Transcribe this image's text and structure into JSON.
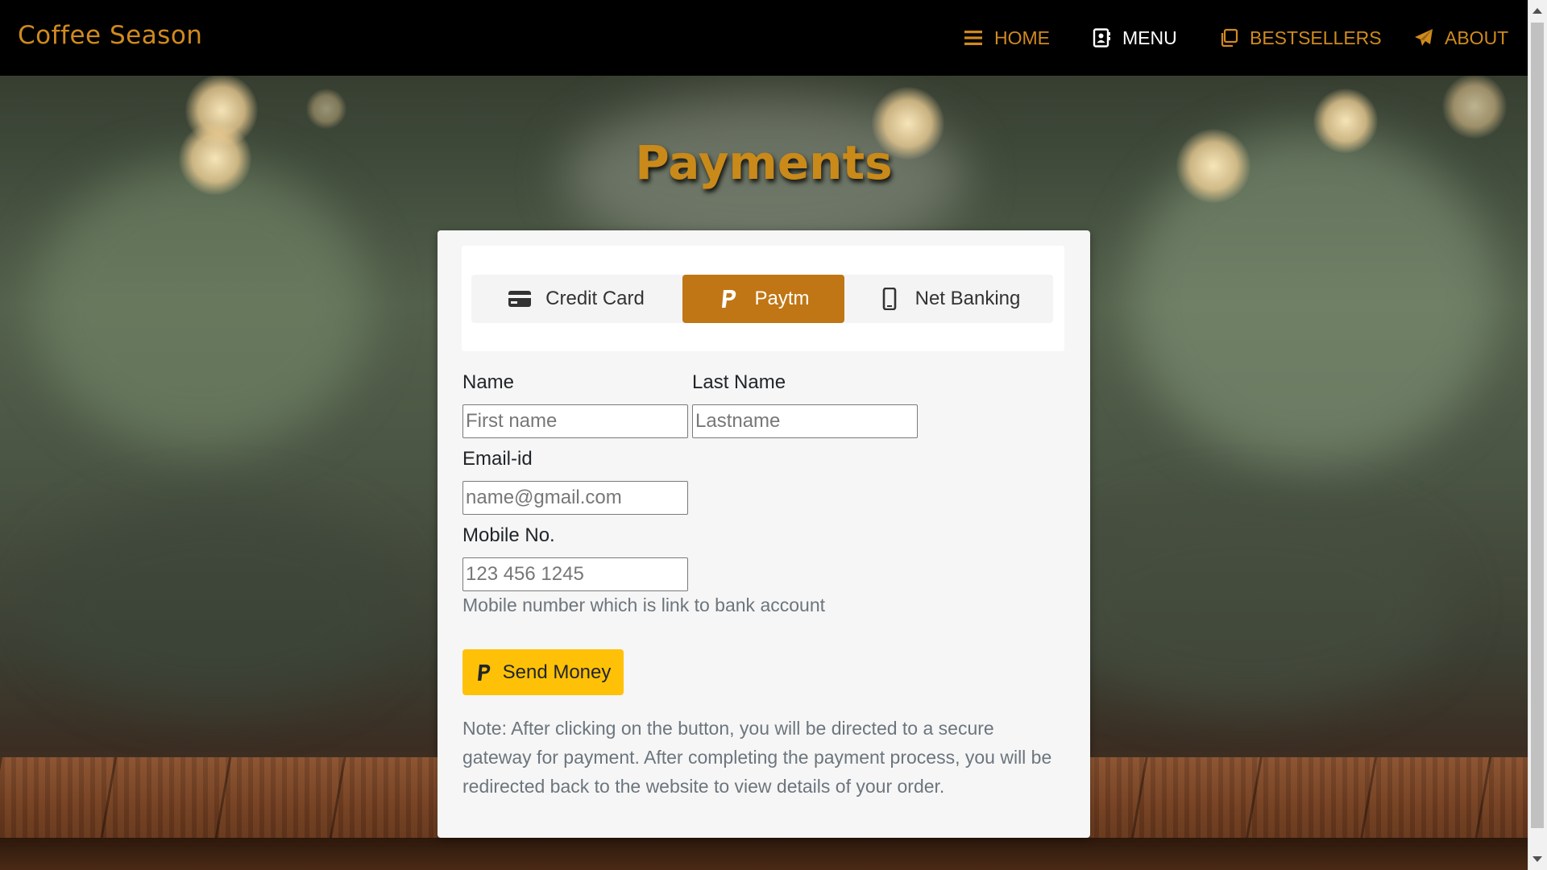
{
  "brand": "Coffee Season",
  "nav": [
    {
      "label": "HOME",
      "icon": "bars-icon",
      "active": false
    },
    {
      "label": "MENU",
      "icon": "address-card-icon",
      "active": true
    },
    {
      "label": "BESTSELLERS",
      "icon": "copy-icon",
      "active": false
    },
    {
      "label": "ABOUT",
      "icon": "paper-plane-icon",
      "active": false
    }
  ],
  "page_title": "Payments",
  "tabs": [
    {
      "label": "Credit Card",
      "icon": "credit-card-icon",
      "active": false
    },
    {
      "label": "Paytm",
      "icon": "paypal-icon",
      "active": true
    },
    {
      "label": "Net Banking",
      "icon": "mobile-icon",
      "active": false
    }
  ],
  "form": {
    "name_label": "Name",
    "first_name_placeholder": "First name",
    "last_name_label": "Last Name",
    "last_name_placeholder": "Lastname",
    "email_label": "Email-id",
    "email_placeholder": "name@gmail.com",
    "mobile_label": "Mobile No.",
    "mobile_placeholder": "123 456 1245",
    "mobile_help": "Mobile number which is link to bank account",
    "send_label": "Send Money",
    "send_icon": "paypal-icon",
    "note": "Note: After clicking on the button, you will be directed to a secure gateway for payment. After completing the payment process, you will be redirected back to the website to view details of your order."
  },
  "colors": {
    "accent": "#c07614",
    "brand": "#d08a1e",
    "button": "#ffc107",
    "navbar": "#000000"
  }
}
